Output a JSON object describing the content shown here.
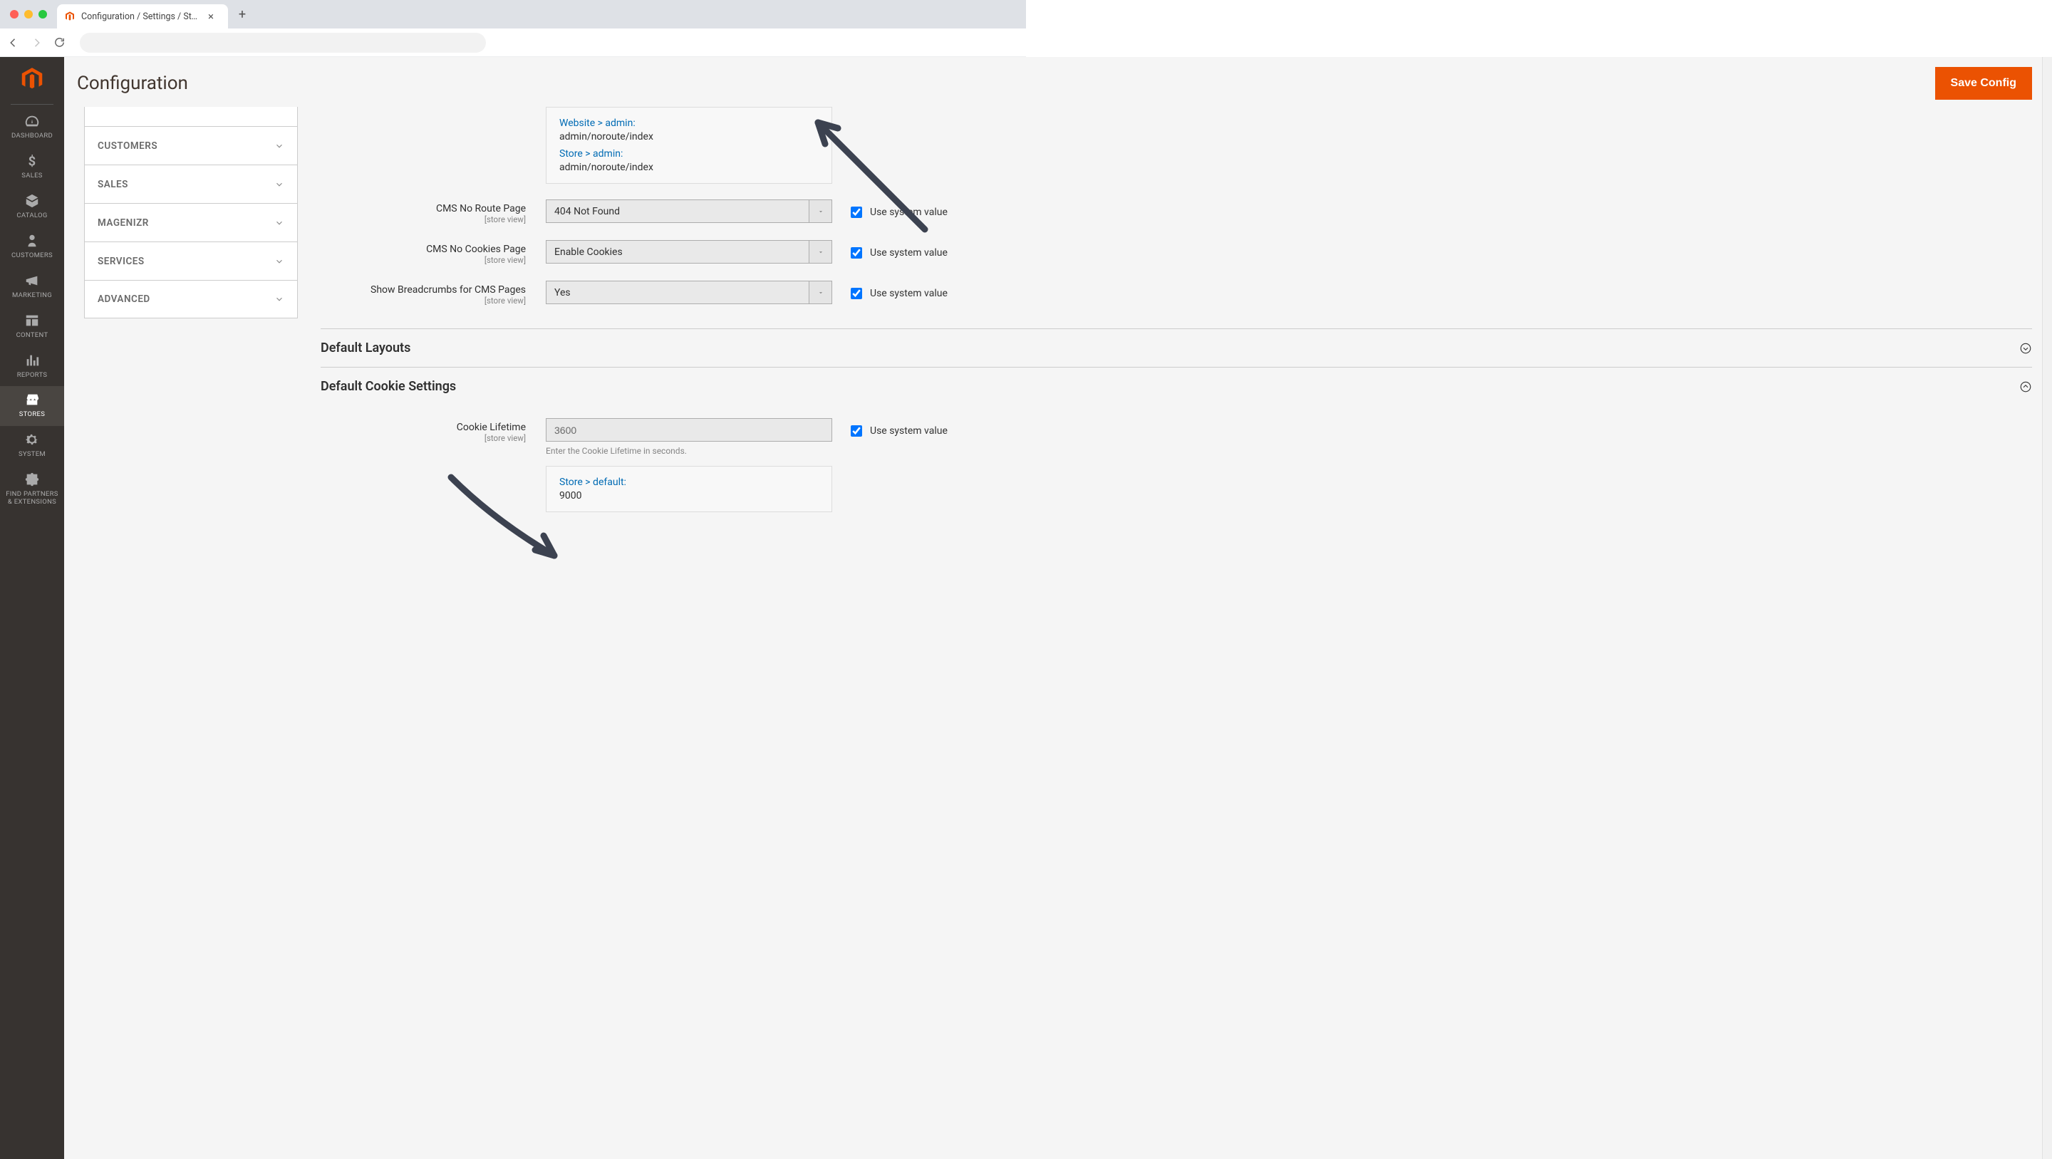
{
  "browser": {
    "tab_title": "Configuration / Settings / Store"
  },
  "page": {
    "title": "Configuration",
    "save_button": "Save Config"
  },
  "rail": {
    "items": [
      {
        "label": "DASHBOARD"
      },
      {
        "label": "SALES"
      },
      {
        "label": "CATALOG"
      },
      {
        "label": "CUSTOMERS"
      },
      {
        "label": "MARKETING"
      },
      {
        "label": "CONTENT"
      },
      {
        "label": "REPORTS"
      },
      {
        "label": "STORES"
      },
      {
        "label": "SYSTEM"
      },
      {
        "label": "FIND PARTNERS\n& EXTENSIONS"
      }
    ]
  },
  "accordion": {
    "items": [
      {
        "label": ""
      },
      {
        "label": "CUSTOMERS"
      },
      {
        "label": "SALES"
      },
      {
        "label": "MAGENIZR"
      },
      {
        "label": "SERVICES"
      },
      {
        "label": "ADVANCED"
      }
    ]
  },
  "scopebox1": {
    "website_link": "Website > admin:",
    "website_val": "admin/noroute/index",
    "store_link": "Store > admin:",
    "store_val": "admin/noroute/index"
  },
  "fields": {
    "cms_noroute": {
      "label": "CMS No Route Page",
      "scope": "[store view]",
      "value": "404 Not Found"
    },
    "cms_nocookies": {
      "label": "CMS No Cookies Page",
      "scope": "[store view]",
      "value": "Enable Cookies"
    },
    "breadcrumbs": {
      "label": "Show Breadcrumbs for CMS Pages",
      "scope": "[store view]",
      "value": "Yes"
    },
    "use_system": "Use system value",
    "cookie_lifetime": {
      "label": "Cookie Lifetime",
      "scope": "[store view]",
      "value": "3600",
      "note": "Enter the Cookie Lifetime in seconds."
    }
  },
  "sections": {
    "default_layouts": "Default Layouts",
    "default_cookie": "Default Cookie Settings"
  },
  "scopebox2": {
    "store_link": "Store > default:",
    "store_val": "9000"
  }
}
